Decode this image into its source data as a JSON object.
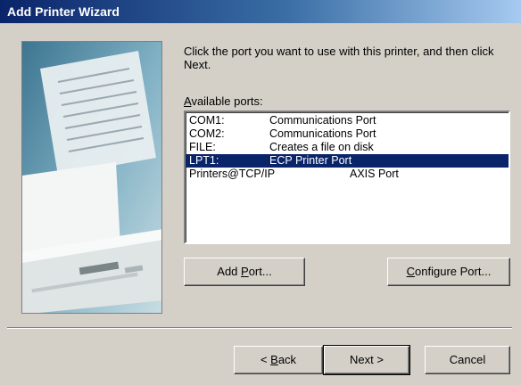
{
  "window": {
    "title": "Add Printer Wizard"
  },
  "instructions": "Click the port you want to use with this printer, and then click Next.",
  "ports_label": {
    "prefix": "",
    "mnemonic": "A",
    "rest": "vailable ports:"
  },
  "ports": [
    {
      "name": "COM1:",
      "description": "Communications Port",
      "selected": false
    },
    {
      "name": "COM2:",
      "description": "Communications Port",
      "selected": false
    },
    {
      "name": "FILE:",
      "description": "Creates a file on disk",
      "selected": false
    },
    {
      "name": "LPT1:",
      "description": "ECP Printer Port",
      "selected": true
    },
    {
      "name": "Printers@TCP/IP",
      "description": "AXIS Port",
      "selected": false
    }
  ],
  "buttons": {
    "add_port": {
      "prefix": "Add ",
      "mnemonic": "P",
      "rest": "ort..."
    },
    "configure_port": {
      "prefix": "",
      "mnemonic": "C",
      "rest": "onfigure Port..."
    },
    "back": {
      "prefix": "< ",
      "mnemonic": "B",
      "rest": "ack"
    },
    "next": {
      "label": "Next >"
    },
    "cancel": {
      "label": "Cancel"
    }
  },
  "colors": {
    "selection": "#0a246a",
    "dialog_bg": "#d4d0c8",
    "title_start": "#0a246a",
    "title_end": "#a6caf0"
  }
}
